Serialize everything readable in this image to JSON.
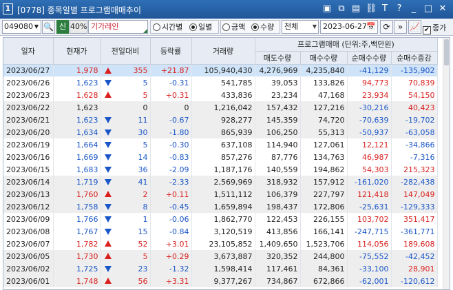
{
  "window": {
    "screen_no": "1",
    "title": "[0778] 종목일별 프로그램매매추이",
    "icons": [
      "memo-icon",
      "window-icon",
      "layout-icon",
      "link-icon",
      "font-icon",
      "help-icon",
      "minimize-icon",
      "maximize-icon",
      "close-icon"
    ]
  },
  "toolbar": {
    "stock_code": "049080",
    "search_glyph": "🔍",
    "sin_label": "신",
    "pct_label": "40%",
    "stock_name": "기가레인",
    "radio_time": "시간별",
    "radio_daily": "일별",
    "radio_amount": "금액",
    "radio_qty": "수량",
    "market_select": "전체",
    "date_value": "2023-06-27",
    "calendar_glyph": "📅",
    "refresh_glyph": "⟳",
    "next_glyph": "»",
    "chart_glyph": "📈",
    "close_price_check": "종가"
  },
  "grid": {
    "headers": {
      "date": "일자",
      "price": "현재가",
      "change": "전일대비",
      "rate": "등락률",
      "volume": "거래량",
      "program_group": "프로그램매매 (단위:주,백만원)",
      "sell": "매도수량",
      "buy": "매수수량",
      "net": "순매수수량",
      "net_change": "순매수증감"
    },
    "rows": [
      {
        "date": "2023/06/27",
        "price": "1,978",
        "dir": "up",
        "change": "355",
        "rate": "+21.87",
        "volume": "105,940,430",
        "sell": "4,276,969",
        "buy": "4,235,840",
        "net": "-41,129",
        "net_change": "-135,902"
      },
      {
        "date": "2023/06/26",
        "price": "1,623",
        "dir": "down",
        "change": "5",
        "rate": "-0.31",
        "volume": "541,785",
        "sell": "39,053",
        "buy": "133,826",
        "net": "94,773",
        "net_change": "70,839"
      },
      {
        "date": "2023/06/23",
        "price": "1,628",
        "dir": "up",
        "change": "5",
        "rate": "+0.31",
        "volume": "433,836",
        "sell": "23,234",
        "buy": "47,168",
        "net": "23,934",
        "net_change": "54,150"
      },
      {
        "date": "2023/06/22",
        "price": "1,623",
        "dir": "flat",
        "change": "0",
        "rate": "0",
        "volume": "1,216,042",
        "sell": "157,432",
        "buy": "127,216",
        "net": "-30,216",
        "net_change": "40,423"
      },
      {
        "date": "2023/06/21",
        "price": "1,623",
        "dir": "down",
        "change": "11",
        "rate": "-0.67",
        "volume": "928,277",
        "sell": "145,359",
        "buy": "74,720",
        "net": "-70,639",
        "net_change": "-19,702"
      },
      {
        "date": "2023/06/20",
        "price": "1,634",
        "dir": "down",
        "change": "30",
        "rate": "-1.80",
        "volume": "865,939",
        "sell": "106,250",
        "buy": "55,313",
        "net": "-50,937",
        "net_change": "-63,058"
      },
      {
        "date": "2023/06/19",
        "price": "1,664",
        "dir": "down",
        "change": "5",
        "rate": "-0.30",
        "volume": "637,108",
        "sell": "114,940",
        "buy": "127,061",
        "net": "12,121",
        "net_change": "-34,866"
      },
      {
        "date": "2023/06/16",
        "price": "1,669",
        "dir": "down",
        "change": "14",
        "rate": "-0.83",
        "volume": "857,276",
        "sell": "87,776",
        "buy": "134,763",
        "net": "46,987",
        "net_change": "-7,316"
      },
      {
        "date": "2023/06/15",
        "price": "1,683",
        "dir": "down",
        "change": "36",
        "rate": "-2.09",
        "volume": "1,187,176",
        "sell": "140,559",
        "buy": "194,862",
        "net": "54,303",
        "net_change": "215,323"
      },
      {
        "date": "2023/06/14",
        "price": "1,719",
        "dir": "down",
        "change": "41",
        "rate": "-2.33",
        "volume": "2,569,969",
        "sell": "318,932",
        "buy": "157,912",
        "net": "-161,020",
        "net_change": "-282,438"
      },
      {
        "date": "2023/06/13",
        "price": "1,760",
        "dir": "up",
        "change": "2",
        "rate": "+0.11",
        "volume": "1,511,112",
        "sell": "106,379",
        "buy": "227,797",
        "net": "121,418",
        "net_change": "147,049"
      },
      {
        "date": "2023/06/12",
        "price": "1,758",
        "dir": "down",
        "change": "8",
        "rate": "-0.45",
        "volume": "1,659,894",
        "sell": "198,437",
        "buy": "172,806",
        "net": "-25,631",
        "net_change": "-129,333"
      },
      {
        "date": "2023/06/09",
        "price": "1,766",
        "dir": "down",
        "change": "1",
        "rate": "-0.06",
        "volume": "1,862,770",
        "sell": "122,453",
        "buy": "226,155",
        "net": "103,702",
        "net_change": "351,417"
      },
      {
        "date": "2023/06/08",
        "price": "1,767",
        "dir": "down",
        "change": "15",
        "rate": "-0.84",
        "volume": "3,120,519",
        "sell": "413,856",
        "buy": "166,141",
        "net": "-247,715",
        "net_change": "-361,771"
      },
      {
        "date": "2023/06/07",
        "price": "1,782",
        "dir": "up",
        "change": "52",
        "rate": "+3.01",
        "volume": "23,105,852",
        "sell": "1,409,650",
        "buy": "1,523,706",
        "net": "114,056",
        "net_change": "189,608"
      },
      {
        "date": "2023/06/05",
        "price": "1,730",
        "dir": "up",
        "change": "5",
        "rate": "+0.29",
        "volume": "3,673,887",
        "sell": "320,352",
        "buy": "244,800",
        "net": "-75,552",
        "net_change": "-42,452"
      },
      {
        "date": "2023/06/02",
        "price": "1,725",
        "dir": "down",
        "change": "23",
        "rate": "-1.32",
        "volume": "1,598,414",
        "sell": "117,461",
        "buy": "84,361",
        "net": "-33,100",
        "net_change": "28,901"
      },
      {
        "date": "2023/06/01",
        "price": "1,748",
        "dir": "up",
        "change": "56",
        "rate": "+3.31",
        "volume": "9,377,267",
        "sell": "734,867",
        "buy": "672,866",
        "net": "-62,001",
        "net_change": "-120,612"
      }
    ]
  },
  "colors": {
    "up": "#d9201f",
    "down": "#1a56c8",
    "selected_row": "#cfe4f8",
    "title_bar": "#2f6fb6"
  }
}
